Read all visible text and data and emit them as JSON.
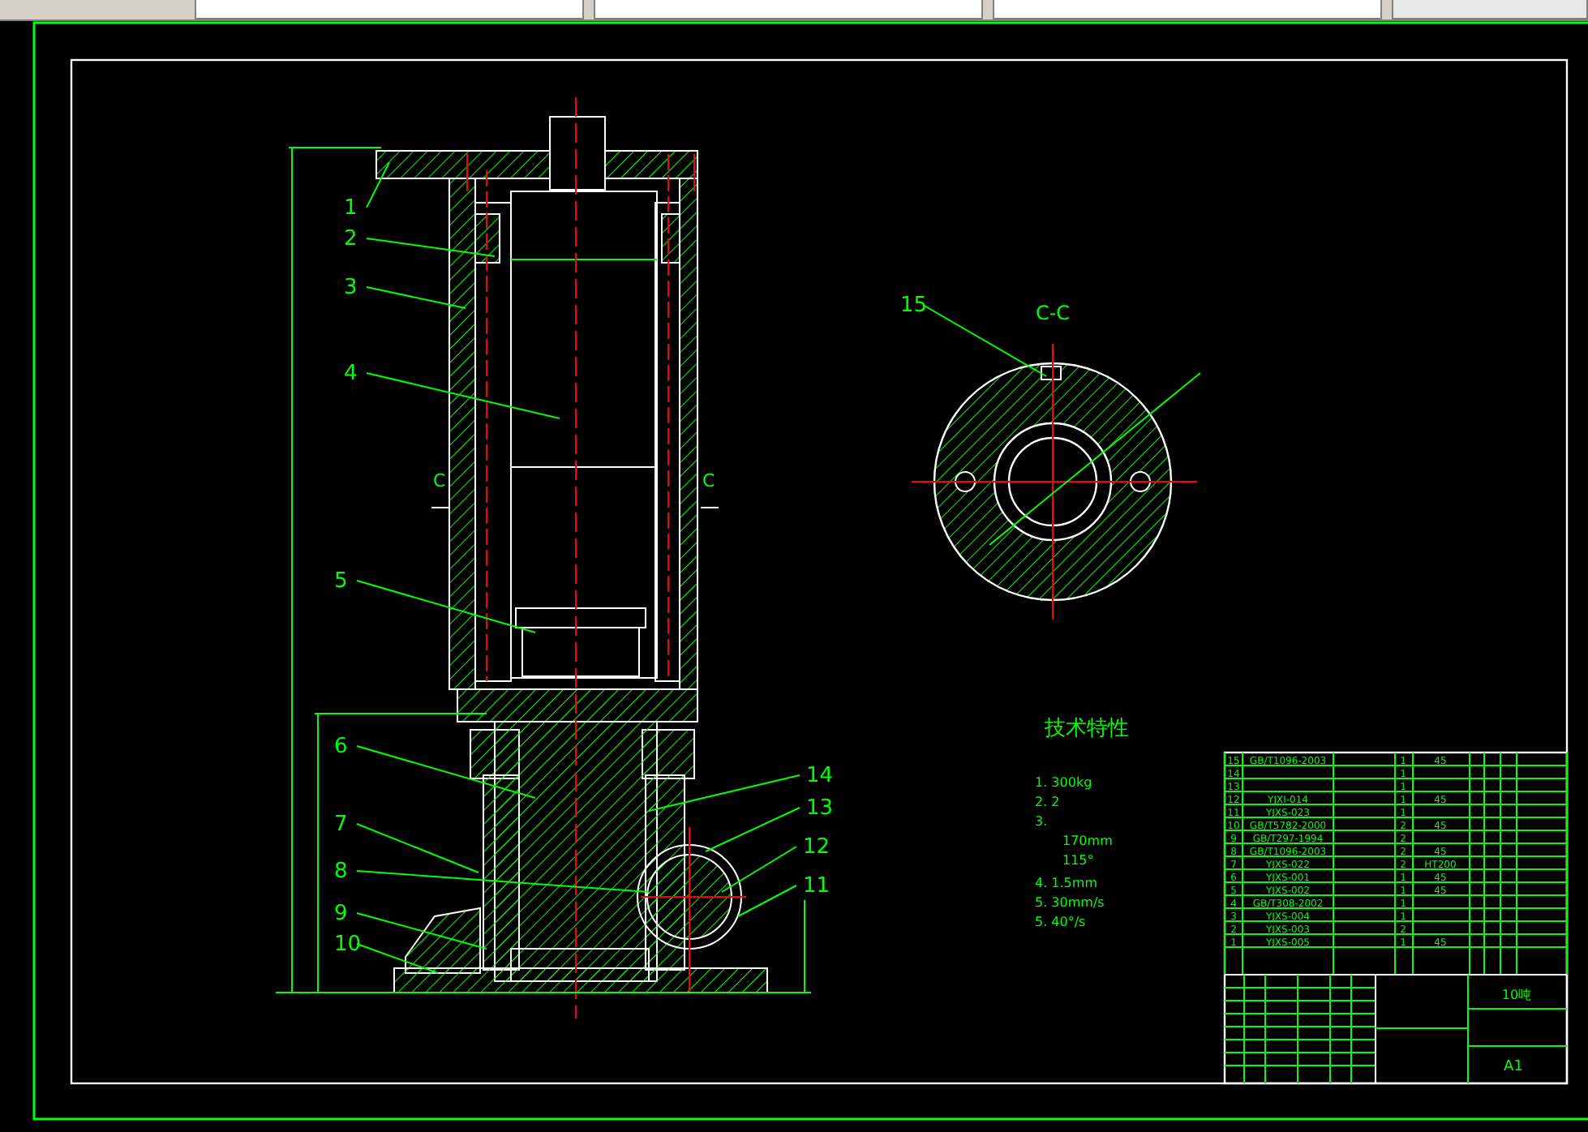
{
  "drawing": {
    "part_labels": [
      "1",
      "2",
      "3",
      "4",
      "5",
      "6",
      "7",
      "8",
      "9",
      "10",
      "15",
      "14",
      "13",
      "12",
      "11"
    ],
    "section_marks": [
      "C",
      "C"
    ],
    "section_title": "C-C",
    "tech_spec": {
      "title": "技术特性",
      "items": [
        {
          "number": "1.",
          "value": "300kg"
        },
        {
          "number": "2.",
          "value": "2"
        },
        {
          "number": "3."
        },
        {
          "value": "170mm"
        },
        {
          "value": "115°"
        },
        {
          "number": "4.",
          "value": "1.5mm"
        },
        {
          "number": "5.",
          "value": "30mm/s"
        },
        {
          "number": "5.",
          "value": "40°/s"
        }
      ]
    },
    "parts_list": [
      {
        "no": "15",
        "code": "GB/T1096-2003",
        "qty": "1",
        "material": "45"
      },
      {
        "no": "14",
        "qty": "1"
      },
      {
        "no": "13",
        "qty": "1"
      },
      {
        "no": "12",
        "code": "YJXI-014",
        "qty": "1",
        "material": "45"
      },
      {
        "no": "11",
        "code": "YJXS-023",
        "qty": "1"
      },
      {
        "no": "10",
        "code": "GB/T5782-2000",
        "qty": "2",
        "material": "45"
      },
      {
        "no": "9",
        "code": "GB/T297-1994",
        "qty": "2"
      },
      {
        "no": "8",
        "code": "GB/T1096-2003",
        "qty": "2",
        "material": "45"
      },
      {
        "no": "7",
        "code": "YJXS-022",
        "qty": "2",
        "material": "HT200"
      },
      {
        "no": "6",
        "code": "YJXS-001",
        "qty": "1",
        "material": "45"
      },
      {
        "no": "5",
        "code": "YJXS-002",
        "qty": "1",
        "material": "45"
      },
      {
        "no": "4",
        "code": "GB/T308-2002",
        "qty": "1"
      },
      {
        "no": "3",
        "code": "YJXS-004",
        "qty": "1"
      },
      {
        "no": "2",
        "code": "YJXS-003",
        "qty": "2"
      },
      {
        "no": "1",
        "code": "YJXS-005",
        "qty": "1",
        "material": "45"
      }
    ],
    "title_block": {
      "drawing_title": "10吨",
      "sheet_size": "A1"
    }
  }
}
